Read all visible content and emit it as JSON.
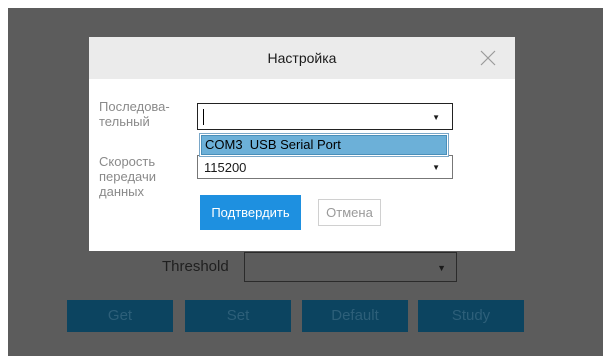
{
  "background": {
    "threshold_label": "Threshold",
    "buttons": {
      "get": "Get",
      "set": "Set",
      "default": "Default",
      "study": "Study"
    }
  },
  "dialog": {
    "title": "Настройка",
    "port_label": "Последова-\nтельный",
    "port_value": "",
    "port_options": [
      "COM3  USB Serial Port"
    ],
    "speed_label": "Скорость\nпередачи\nданных",
    "speed_value": "115200",
    "confirm_label": "Подтвердить",
    "cancel_label": "Отмена"
  },
  "colors": {
    "overlay": "#5c5c5c",
    "primary": "#1e90e0",
    "background_button": "#0c4460",
    "highlight": "#6cb0d8"
  },
  "icons": {
    "close": "close-icon",
    "dropdown": "chevron-down-icon"
  }
}
